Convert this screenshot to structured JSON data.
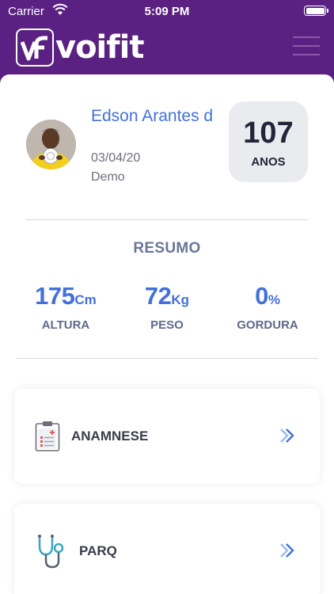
{
  "status_bar": {
    "carrier": "Carrier",
    "time": "5:09 PM"
  },
  "header": {
    "logo_text": "voifit"
  },
  "profile": {
    "name": "Edson Arantes d",
    "birth_date": "03/04/20",
    "plan": "Demo",
    "age_value": "107",
    "age_unit": "ANOS"
  },
  "summary": {
    "title": "RESUMO",
    "stats": [
      {
        "value": "175",
        "unit": "Cm",
        "label": "ALTURA"
      },
      {
        "value": "72",
        "unit": "Kg",
        "label": "PESO"
      },
      {
        "value": "0",
        "unit": "%",
        "label": "GORDURA"
      }
    ]
  },
  "menu": [
    {
      "label": "ANAMNESE",
      "icon": "clipboard-icon"
    },
    {
      "label": "PARQ",
      "icon": "stethoscope-icon"
    }
  ],
  "colors": {
    "brand_purple": "#5a2182",
    "accent_blue": "#4470d8"
  }
}
